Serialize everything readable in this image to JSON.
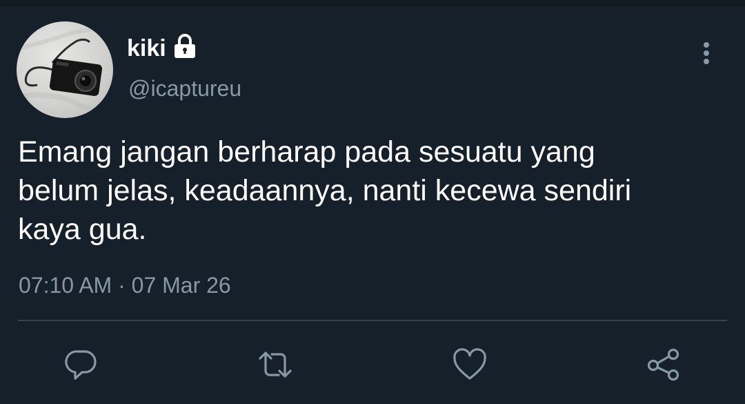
{
  "tweet": {
    "author": {
      "display_name": "kiki",
      "handle": "@icaptureu",
      "avatar_icon": "camera-photo-avatar",
      "locked_icon": "lock-icon"
    },
    "text": "Emang jangan berharap pada sesuatu yang\nbelum jelas, keadaannya, nanti kecewa sendiri\nkaya gua.",
    "time": "07:10 AM",
    "separator": "·",
    "date": "07 Mar 26"
  },
  "actions": [
    {
      "name": "reply",
      "icon": "reply-icon"
    },
    {
      "name": "retweet",
      "icon": "retweet-icon"
    },
    {
      "name": "like",
      "icon": "heart-icon"
    },
    {
      "name": "share",
      "icon": "share-icon"
    }
  ],
  "menu_icon": "more-vertical-icon",
  "colors": {
    "background": "#15202b",
    "primary_text": "#ffffff",
    "secondary_text": "#8899a6",
    "divider": "#38444d"
  }
}
